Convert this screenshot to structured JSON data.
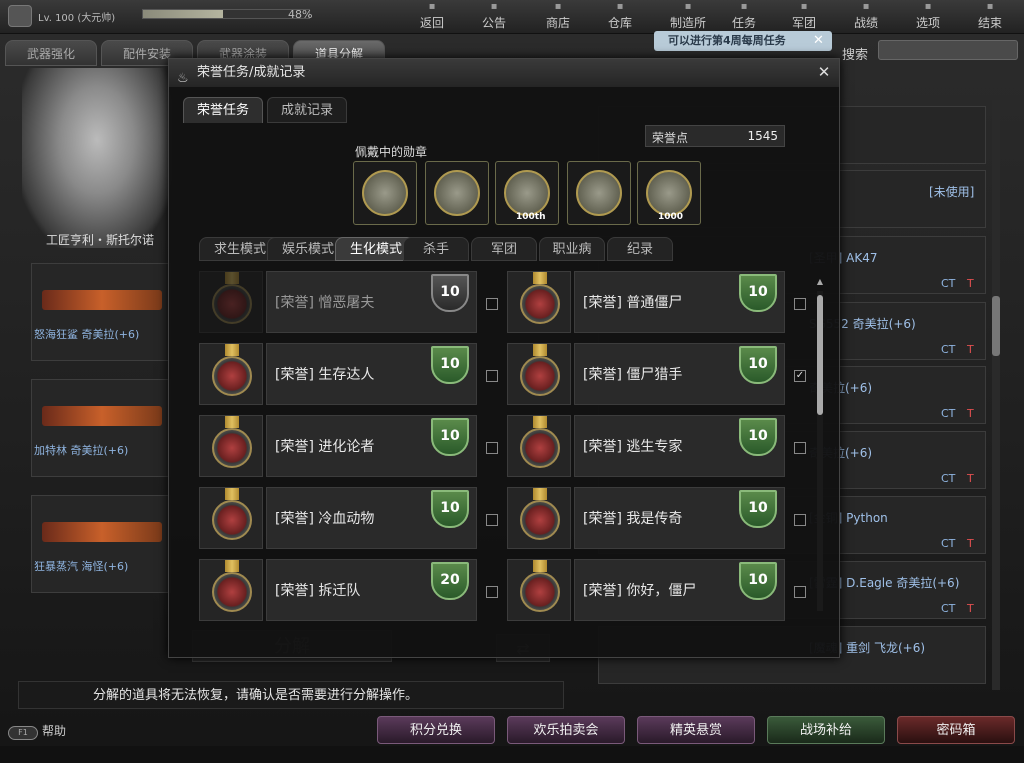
{
  "topbar": {
    "level": "Lv. 100 (大元帅)",
    "exp_percent_text": "48%",
    "exp_fraction": 0.48,
    "nav": [
      {
        "label": "返回",
        "icon": "back-icon"
      },
      {
        "label": "公告",
        "icon": "notice-icon"
      },
      {
        "label": "商店",
        "icon": "shop-icon"
      },
      {
        "label": "仓库",
        "icon": "warehouse-icon"
      },
      {
        "label": "制造所",
        "icon": "factory-icon"
      },
      {
        "label": "任务",
        "icon": "mission-icon"
      },
      {
        "label": "军团",
        "icon": "clan-icon"
      },
      {
        "label": "战绩",
        "icon": "record-icon"
      },
      {
        "label": "选项",
        "icon": "options-icon"
      },
      {
        "label": "结束",
        "icon": "exit-icon"
      }
    ]
  },
  "left": {
    "tabs": [
      "武器强化",
      "配件安装",
      "武器涂装",
      "道具分解"
    ],
    "npc_name": "工匠亨利・斯托尔诺",
    "weapons": [
      {
        "name": "怒海狂鲨 奇美拉(+6)"
      },
      {
        "name": "加特林 奇美拉(+6)"
      },
      {
        "name": "狂暴蒸汽 海怪(+6)"
      }
    ]
  },
  "right": {
    "notice": "可以进行第4周每周任务",
    "search_label": "搜索",
    "unused": "[未使用]",
    "items": [
      {
        "name": "[圣甲] AK47",
        "ct": "CT",
        "t": "T"
      },
      {
        "name": "SG552 奇美拉(+6)",
        "ct": "CT",
        "t": "T"
      },
      {
        "name": "奇美拉(+6)",
        "ct": "CT",
        "t": "T"
      },
      {
        "name": "奇美拉(+6)",
        "ct": "CT",
        "t": "T"
      },
      {
        "name": "[金铜] Python",
        "ct": "CT",
        "t": "T"
      },
      {
        "name": "[雷霆] D.Eagle 奇美拉(+6)",
        "ct": "CT",
        "t": "T"
      },
      {
        "name": "[魔魂] 重剑 飞龙(+6)"
      }
    ]
  },
  "bottom": {
    "decompose": "分解",
    "warning": "分解的道具将无法恢复，请确认是否需要进行分解操作。",
    "help": "帮助",
    "help_key": "F1",
    "buttons": [
      "积分兑换",
      "欢乐拍卖会",
      "精英悬赏",
      "战场补给",
      "密码箱"
    ]
  },
  "modal": {
    "title": "荣誉任务/成就记录",
    "tabs": [
      "荣誉任务",
      "成就记录"
    ],
    "honor_label": "荣誉点",
    "honor_value": "1545",
    "worn_label": "佩戴中的勋章",
    "worn_medals": [
      {
        "icon": "medal-no-zombie-icon",
        "tag": ""
      },
      {
        "icon": "medal-guns-gold-icon",
        "tag": ""
      },
      {
        "icon": "medal-100th-icon",
        "tag": "100th"
      },
      {
        "icon": "medal-zombie-face-icon",
        "tag": ""
      },
      {
        "icon": "medal-1000-icon",
        "tag": "1000"
      }
    ],
    "subtabs": [
      "求生模式",
      "娱乐模式",
      "生化模式",
      "杀手",
      "军团",
      "职业病",
      "纪录"
    ],
    "active_subtab": 2,
    "achievements_left": [
      {
        "name": "[荣誉] 憎恶屠夫",
        "level": "10",
        "checked": false,
        "done": false
      },
      {
        "name": "[荣誉] 生存达人",
        "level": "10",
        "checked": false,
        "done": true
      },
      {
        "name": "[荣誉] 进化论者",
        "level": "10",
        "checked": false,
        "done": true
      },
      {
        "name": "[荣誉] 冷血动物",
        "level": "10",
        "checked": false,
        "done": true
      },
      {
        "name": "[荣誉] 拆迁队",
        "level": "20",
        "checked": false,
        "done": true
      }
    ],
    "achievements_right": [
      {
        "name": "[荣誉] 普通僵尸",
        "level": "10",
        "checked": false,
        "done": true
      },
      {
        "name": "[荣誉] 僵尸猎手",
        "level": "10",
        "checked": true,
        "done": true
      },
      {
        "name": "[荣誉] 逃生专家",
        "level": "10",
        "checked": false,
        "done": true
      },
      {
        "name": "[荣誉] 我是传奇",
        "level": "10",
        "checked": false,
        "done": true
      },
      {
        "name": "[荣誉] 你好，僵尸",
        "level": "10",
        "checked": false,
        "done": true
      }
    ]
  }
}
